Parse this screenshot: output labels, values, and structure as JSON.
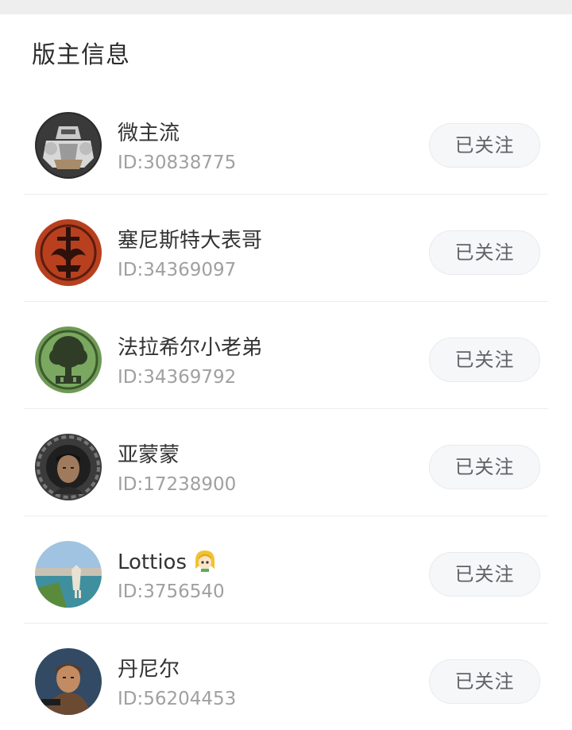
{
  "section": {
    "title": "版主信息"
  },
  "moderators": [
    {
      "name": "微主流",
      "id": "ID:30838775",
      "follow_label": "已关注",
      "avatar": "armor-knight-avatar"
    },
    {
      "name": "塞尼斯特大表哥",
      "id": "ID:34369097",
      "follow_label": "已关注",
      "avatar": "red-sword-emblem-avatar"
    },
    {
      "name": "法拉希尔小老弟",
      "id": "ID:34369792",
      "follow_label": "已关注",
      "avatar": "green-tree-emblem-avatar"
    },
    {
      "name": "亚蒙蒙",
      "id": "ID:17238900",
      "follow_label": "已关注",
      "avatar": "portrait-man-avatar"
    },
    {
      "name": "Lottios",
      "id": "ID:3756540",
      "follow_label": "已关注",
      "avatar": "landscape-avatar",
      "badge": "blonde-character-icon"
    },
    {
      "name": "丹尼尔",
      "id": "ID:56204453",
      "follow_label": "已关注",
      "avatar": "medieval-character-avatar"
    }
  ],
  "colors": {
    "follow_bg": "#f6f7f9",
    "id_text": "#a0a0a0",
    "divider": "#ececec"
  }
}
